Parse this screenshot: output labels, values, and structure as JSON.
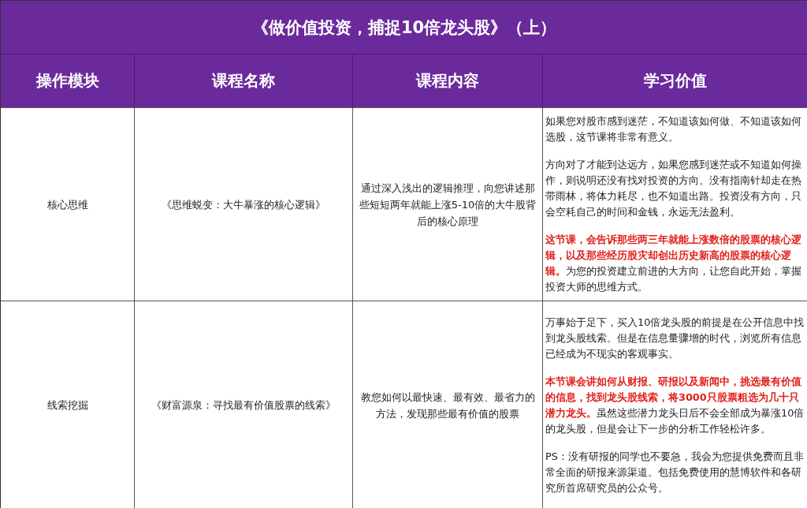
{
  "title": "《做价值投资，捕捉10倍龙头股》（上）",
  "columns": [
    "操作模块",
    "课程名称",
    "课程内容",
    "学习价值"
  ],
  "rows": [
    {
      "module": "核心思维",
      "course_name": "《思维蜕变：大牛暴涨的核心逻辑》",
      "content": "通过深入浅出的逻辑推理，向您讲述那些短短两年就能上涨5-10倍的大牛股背后的核心原理",
      "value": [
        "如果您对股市感到迷茫，不知道该如何做、不知道该如何选股，这节课将非常有意义。",
        "方向对了才能到达远方，如果您感到迷茫或不知道如何操作，则说明还没有找对投资的方向。没有指南针却走在热带雨林，将体力耗尽，也不知道出路。投资没有方向，只会空耗自己的时间和金钱，永远无法盈利。",
        "**这节课，会告诉那些两三年就能上涨数倍的股票的核心逻辑，以及那些经历股灾却创出历史新高的股票的核心逻辑。**为您的投资建立前进的大方向，让您自此开始，掌握投资大师的思维方式。"
      ]
    },
    {
      "module": "线索挖掘",
      "course_name": "《财富源泉：寻找最有价值股票的线索》",
      "content": "教您如何以最快速、最有效、最省力的方法，发现那些最有价值的股票",
      "value": [
        "万事始于足下，买入10倍龙头股的前提是在公开信息中找到龙头股线索。但是在信息量骤增的时代，浏览所有信息已经成为不现实的客观事实。",
        "**本节课会讲如何从财报、研报以及新闻中，挑选最有价值的信息，找到龙头股线索，将3000只股票粗选为几十只潜力龙头。**虽然这些潜力龙头日后不会全部成为暴涨10倍的龙头股，但是会让下一步的分析工作轻松许多。",
        "PS：没有研报的同学也不要急，我会为您提供免费而且非常全面的研报来源渠道。包括免费使用的慧博软件和各研究所首席研究员的公众号。"
      ]
    }
  ]
}
